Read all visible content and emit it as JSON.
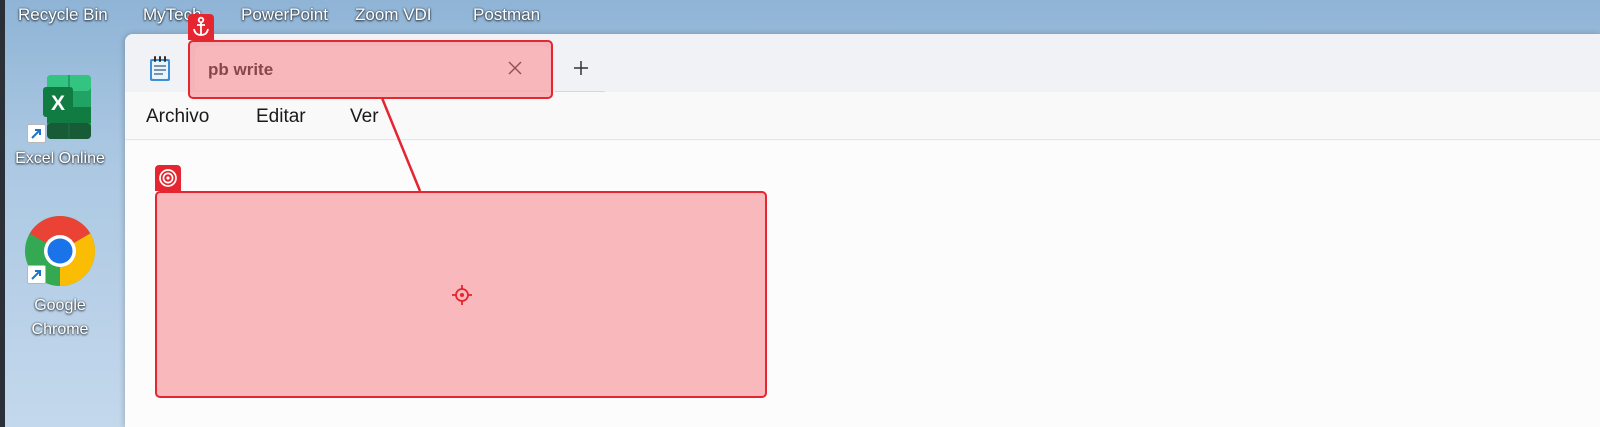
{
  "desktop": {
    "top_labels": [
      "Recycle Bin",
      "MyTech",
      "PowerPoint",
      "Zoom VDI",
      "Postman"
    ],
    "icons": [
      {
        "label": "Excel Online",
        "icon": "excel-icon"
      },
      {
        "label_line1": "Google",
        "label_line2": "Chrome",
        "icon": "chrome-icon"
      }
    ]
  },
  "notepad": {
    "app_icon": "notepad-icon",
    "tab": {
      "title": "pb write",
      "close_icon": "close-icon"
    },
    "new_tab_icon": "plus-icon",
    "menu": [
      "Archivo",
      "Editar",
      "Ver"
    ],
    "editor_text": ""
  },
  "annotations": {
    "anchor_icon": "anchor-icon",
    "target_icon": "target-icon",
    "crosshair_icon": "crosshair-icon",
    "color": "#e5252f"
  }
}
